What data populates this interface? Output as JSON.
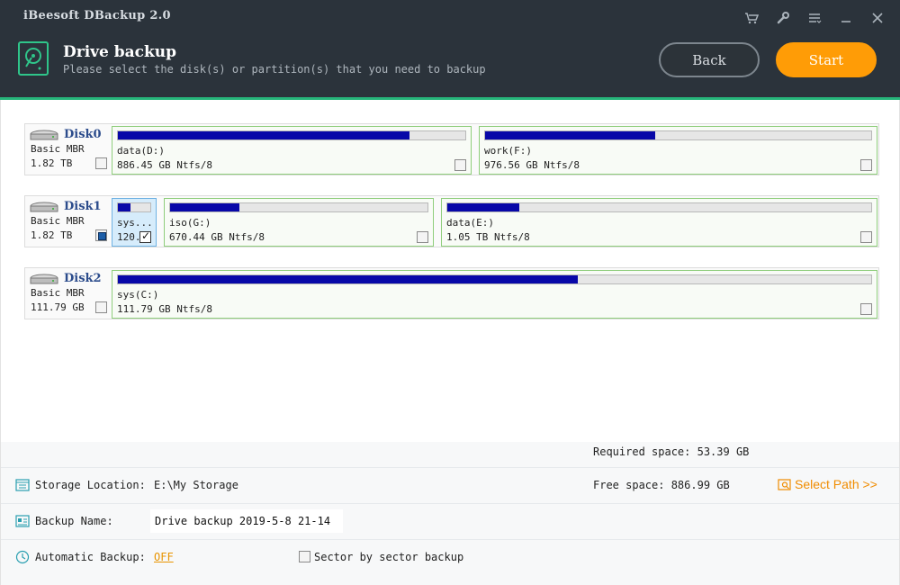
{
  "app": {
    "title": "iBeesoft DBackup 2.0",
    "top_icons": [
      "cart-icon",
      "wrench-icon",
      "menu-icon",
      "minimize-icon",
      "close-icon"
    ]
  },
  "header": {
    "title": "Drive backup",
    "subtitle": "Please select the disk(s) or partition(s) that you need to backup",
    "back_label": "Back",
    "start_label": "Start"
  },
  "disks": [
    {
      "name": "Disk0",
      "type": "Basic MBR",
      "size": "1.82 TB",
      "checked": false,
      "partitions": [
        {
          "label": "data(D:)",
          "size": "886.45 GB Ntfs/8",
          "used_fraction": 0.84,
          "checked": false
        },
        {
          "label": "work(F:)",
          "size": "976.56 GB Ntfs/8",
          "used_fraction": 0.44,
          "checked": false
        }
      ]
    },
    {
      "name": "Disk1",
      "type": "Basic MBR",
      "size": "1.82 TB",
      "checked": "partial",
      "partitions": [
        {
          "label": "sys...",
          "size": "120.",
          "used_fraction": 0.4,
          "checked": true
        },
        {
          "label": "iso(G:)",
          "size": "670.44 GB Ntfs/8",
          "used_fraction": 0.27,
          "checked": false
        },
        {
          "label": "data(E:)",
          "size": "1.05 TB Ntfs/8",
          "used_fraction": 0.17,
          "checked": false
        }
      ]
    },
    {
      "name": "Disk2",
      "type": "Basic MBR",
      "size": "111.79 GB",
      "checked": false,
      "partitions": [
        {
          "label": "sys(C:)",
          "size": "111.79 GB Ntfs/8",
          "used_fraction": 0.61,
          "checked": false
        }
      ]
    }
  ],
  "bottom": {
    "required_space": "Required space: 53.39 GB",
    "storage_label": "Storage Location:",
    "storage_value": "E:\\My Storage",
    "free_space": "Free space: 886.99 GB",
    "select_path": "Select Path >>",
    "backup_name_label": "Backup Name:",
    "backup_name_value": "Drive backup 2019-5-8 21-14",
    "auto_backup_label": "Automatic Backup:",
    "auto_backup_value": "OFF",
    "sector_label": "Sector by sector backup"
  },
  "colors": {
    "header_bg": "#2b333b",
    "accent_green": "#26b57a",
    "start_orange": "#ff9c06",
    "bar_fill": "#0808a8"
  }
}
